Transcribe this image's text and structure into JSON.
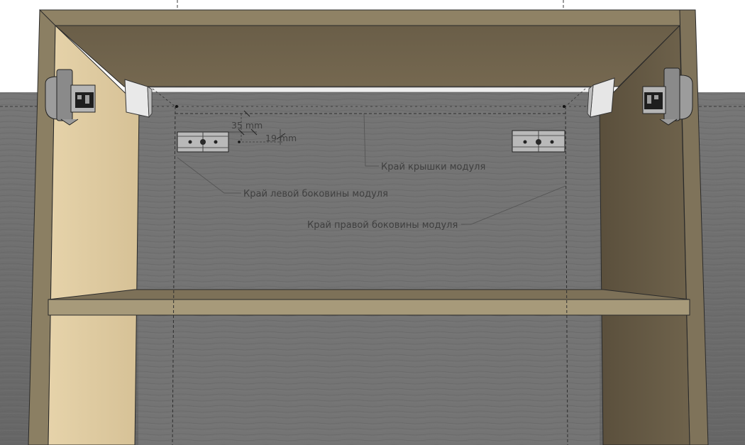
{
  "annotations": {
    "top_edge": "Край крышки модуля",
    "left_edge": "Край левой боковины модуля",
    "right_edge": "Край правой боковины модуля"
  },
  "dimensions": {
    "d1": "35 mm",
    "d2": "19 mm"
  },
  "colors": {
    "wall": "#6f6f6f",
    "panel_light": "#e2cfa6",
    "panel_dark": "#6b5f49",
    "panel_mid": "#8e8062",
    "metal": "#9a9a9a"
  }
}
